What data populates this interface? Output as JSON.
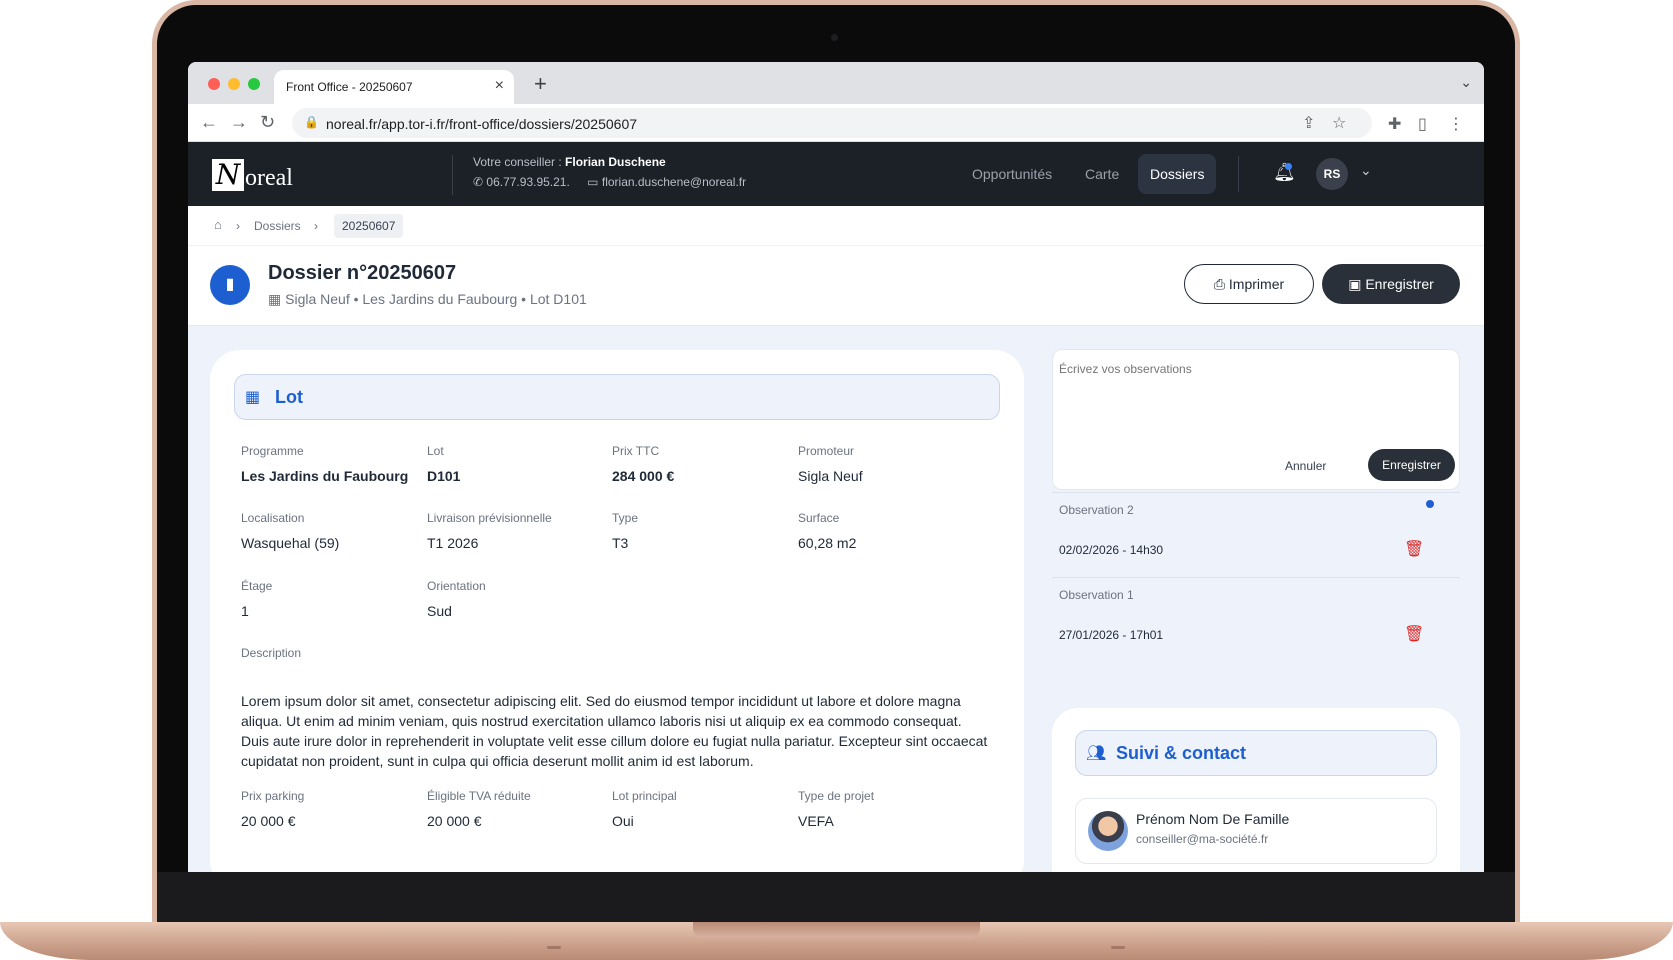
{
  "browser": {
    "tab_title": "Front Office - 20250607",
    "url": "noreal.fr/app.tor-i.fr/front-office/dossiers/20250607"
  },
  "header": {
    "logo_letter": "N",
    "logo_rest": "oreal",
    "advisor_label": "Votre conseiller : ",
    "advisor_name": "Florian Duschene",
    "advisor_phone": "06.77.93.95.21.",
    "advisor_email": "florian.duschene@noreal.fr",
    "nav": [
      "Opportunités",
      "Carte",
      "Dossiers"
    ],
    "avatar_initials": "RS"
  },
  "breadcrumb": {
    "dossiers": "Dossiers",
    "current": "20250607"
  },
  "page": {
    "title": "Dossier n°20250607",
    "subtitle": "Sigla Neuf • Les Jardins du Faubourg • Lot D101",
    "print_label": "Imprimer",
    "save_label": "Enregistrer"
  },
  "lot": {
    "title": "Lot",
    "fields": [
      {
        "label": "Programme",
        "value": "Les Jardins du Faubourg"
      },
      {
        "label": "Lot",
        "value": "D101"
      },
      {
        "label": "Prix TTC",
        "value": "284 000 €"
      },
      {
        "label": "Promoteur",
        "value": "Sigla Neuf"
      },
      {
        "label": "Localisation",
        "value": "Wasquehal (59)"
      },
      {
        "label": "Livraison prévisionnelle",
        "value": "T1 2026"
      },
      {
        "label": "Type",
        "value": "T3"
      },
      {
        "label": "Surface",
        "value": "60,28 m2"
      },
      {
        "label": "Étage",
        "value": "1"
      },
      {
        "label": "Orientation",
        "value": "Sud"
      },
      {
        "label": "Prix parking",
        "value": "20 000 €"
      },
      {
        "label": "Éligible TVA réduite",
        "value": "20 000 €"
      },
      {
        "label": "Lot principal",
        "value": "Oui"
      },
      {
        "label": "Type de projet",
        "value": "VEFA"
      }
    ],
    "description_label": "Description",
    "description": "Lorem ipsum dolor sit amet, consectetur adipiscing elit. Sed do eiusmod tempor incididunt ut labore et dolore magna aliqua. Ut enim ad minim veniam, quis nostrud exercitation ullamco laboris nisi ut aliquip ex ea commodo consequat. Duis aute irure dolor in reprehenderit in voluptate velit esse cillum dolore eu fugiat nulla pariatur. Excepteur sint occaecat cupidatat non proident, sunt in culpa qui officia deserunt mollit anim id est laborum."
  },
  "observations": {
    "placeholder": "Écrivez vos observations",
    "cancel_label": "Annuler",
    "save_label": "Enregistrer",
    "items": [
      {
        "title": "Observation 2",
        "date": "02/02/2026 - 14h30"
      },
      {
        "title": "Observation 1",
        "date": "27/01/2026 - 17h01"
      }
    ]
  },
  "suivi": {
    "title": "Suivi & contact",
    "contact_name": "Prénom Nom De Famille",
    "contact_email": "conseiller@ma-société.fr"
  },
  "colors": {
    "accent": "#1d5fd0",
    "header_bg": "#1c2027",
    "danger": "#dc2626"
  }
}
